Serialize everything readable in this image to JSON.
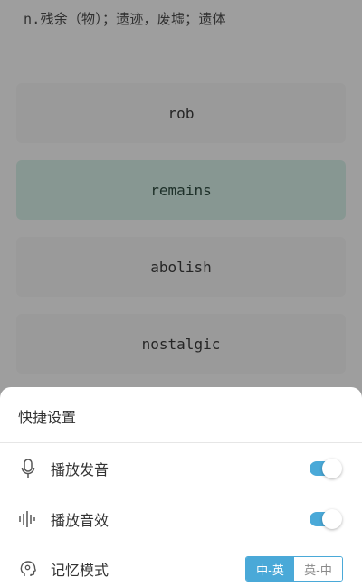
{
  "question": {
    "definition": "n.残余（物）；遗迹，废墟；遗体"
  },
  "options": [
    {
      "word": "rob"
    },
    {
      "word": "remains"
    },
    {
      "word": "abolish"
    },
    {
      "word": "nostalgic"
    }
  ],
  "quick_settings": {
    "title": "快捷设置",
    "items": [
      {
        "label": "播放发音",
        "icon": "microphone-icon",
        "enabled": true
      },
      {
        "label": "播放音效",
        "icon": "sound-wave-icon",
        "enabled": true
      },
      {
        "label": "记忆模式",
        "icon": "brain-icon"
      }
    ],
    "memory_mode": {
      "options": [
        "中-英",
        "英-中"
      ],
      "selected": "中-英"
    }
  },
  "colors": {
    "accent": "#4aa9d8",
    "selected_option": "#cfe9e0"
  }
}
